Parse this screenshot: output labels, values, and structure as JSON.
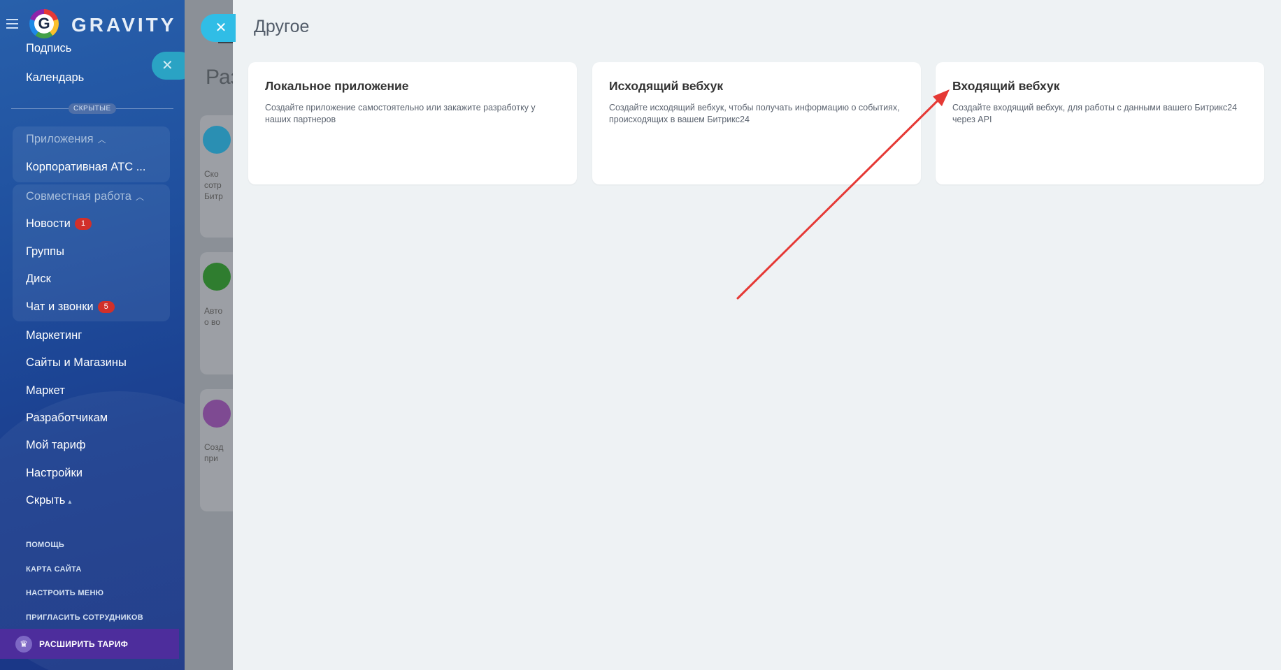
{
  "sidebar": {
    "logo_text": "GRAVITY",
    "logo_letter": "G",
    "partial_item": "Подпись",
    "calendar": "Календарь",
    "hidden_divider": "СКРЫТЫЕ",
    "groups": [
      {
        "header": "Приложения",
        "items": [
          {
            "label": "Корпоративная АТС ...",
            "badge": ""
          }
        ]
      },
      {
        "header": "Совместная работа",
        "items": [
          {
            "label": "Новости",
            "badge": "1"
          },
          {
            "label": "Группы",
            "badge": ""
          },
          {
            "label": "Диск",
            "badge": ""
          },
          {
            "label": "Чат и звонки",
            "badge": "5"
          }
        ]
      }
    ],
    "items": [
      "Маркетинг",
      "Сайты и Магазины",
      "Маркет",
      "Разработчикам",
      "Мой тариф",
      "Настройки",
      "Скрыть"
    ],
    "footer_links": [
      "ПОМОЩЬ",
      "КАРТА САЙТА",
      "НАСТРОИТЬ МЕНЮ",
      "ПРИГЛАСИТЬ СОТРУДНИКОВ"
    ],
    "upgrade_label": "РАСШИРИТЬ ТАРИФ"
  },
  "background_page": {
    "title_fragment": "Раз",
    "card_texts": [
      [
        "Ско",
        "сотр",
        "Битр"
      ],
      [
        "Авто",
        "о во"
      ],
      [
        "Созд",
        "при"
      ]
    ],
    "icon_colors": [
      "#2aa0c8",
      "#3a9a3a",
      "#9b59b6"
    ]
  },
  "panel": {
    "title": "Другое",
    "cards": [
      {
        "title": "Локальное приложение",
        "description": "Создайте приложение самостоятельно или закажите разработку у наших партнеров"
      },
      {
        "title": "Исходящий вебхук",
        "description": "Создайте исходящий вебхук, чтобы получать информацию о событиях, происходящих в вашем Битрикс24"
      },
      {
        "title": "Входящий вебхук",
        "description": "Создайте входящий вебхук, для работы с данными вашего Битрикс24 через API"
      }
    ]
  },
  "colors": {
    "sidebar_bg": "#1f4f9e",
    "badge": "#d1302a",
    "upgrade": "#4d2d9c",
    "close_button": "#30bde6",
    "panel_bg": "#eef2f4",
    "annotation_arrow": "#e53935"
  },
  "icons": {
    "close": "close-icon",
    "menu": "hamburger-menu-icon",
    "chevron": "chevron-up-icon",
    "crown": "crown-icon"
  }
}
